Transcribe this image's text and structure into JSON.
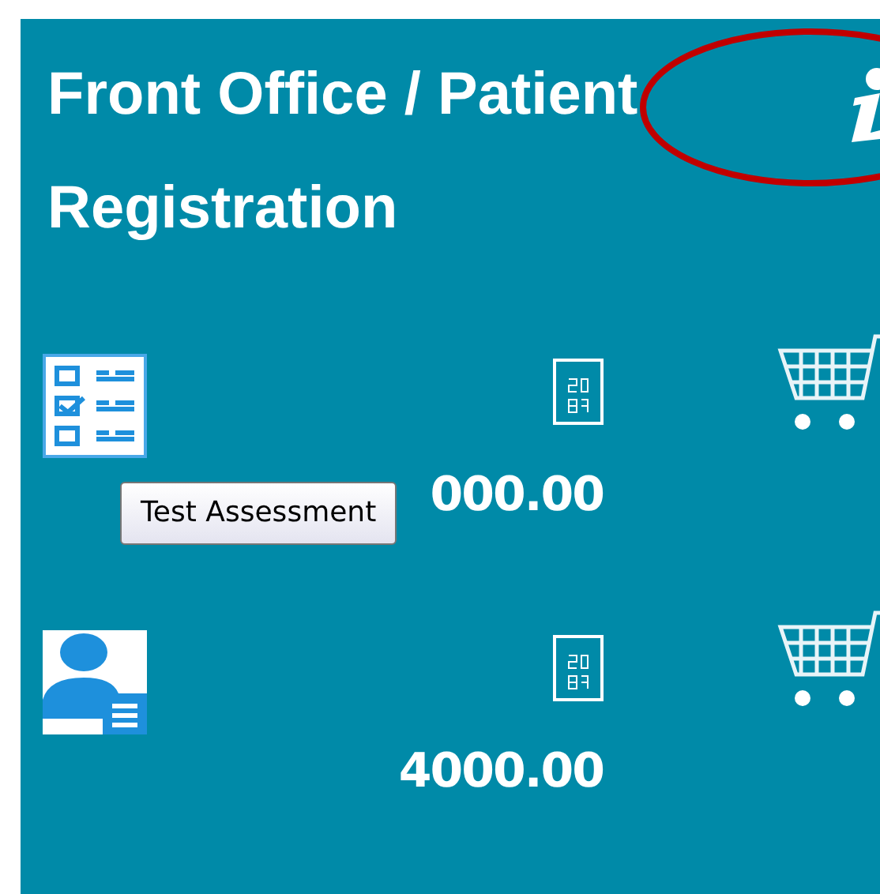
{
  "panel": {
    "title": "Front Office / Patient Registration"
  },
  "items": [
    {
      "kind": "assessment",
      "price": "000.00"
    },
    {
      "kind": "patient",
      "price": "4000.00"
    }
  ],
  "tooltip": {
    "text": "Test Assessment"
  }
}
